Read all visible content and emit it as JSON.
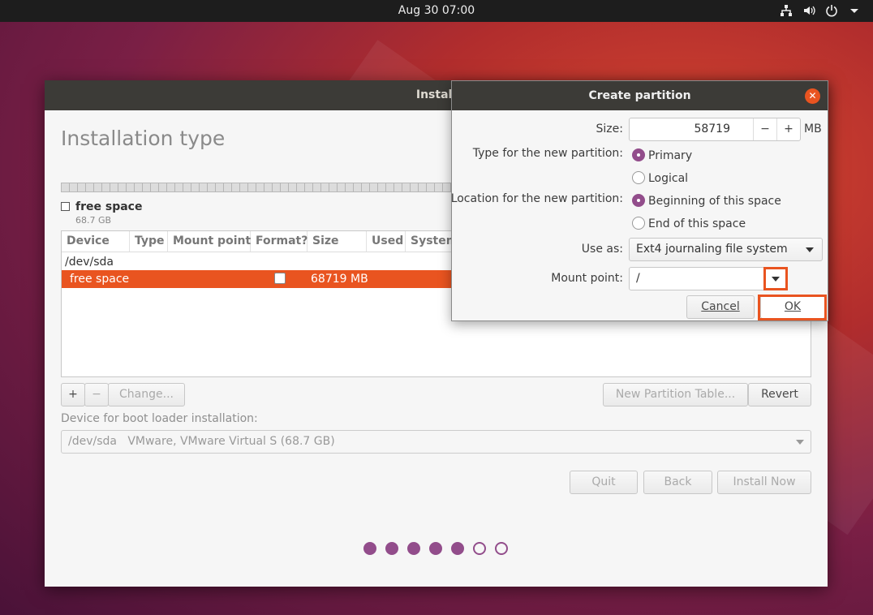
{
  "topbar": {
    "clock": "Aug 30  07:00",
    "icons": [
      "network-icon",
      "volume-icon",
      "power-icon",
      "chevron-down-icon"
    ]
  },
  "installer": {
    "window_title": "Install",
    "page_title": "Installation type",
    "legend": {
      "label": "free space",
      "size": "68.7 GB"
    },
    "table": {
      "columns": [
        "Device",
        "Type",
        "Mount point",
        "Format?",
        "Size",
        "Used",
        "System"
      ],
      "device_row": "/dev/sda",
      "selected_row": {
        "device": "free space",
        "size": "68719 MB"
      }
    },
    "buttons": {
      "add": "+",
      "remove": "−",
      "change": "Change...",
      "new_table": "New Partition Table...",
      "revert": "Revert",
      "quit": "Quit",
      "back": "Back",
      "install_now": "Install Now"
    },
    "boot_loader": {
      "label": "Device for boot loader installation:",
      "value": "/dev/sda   VMware, VMware Virtual S (68.7 GB)"
    },
    "progress": {
      "total": 7,
      "completed": 5
    }
  },
  "dialog": {
    "title": "Create partition",
    "size": {
      "label": "Size:",
      "value": "58719",
      "unit": "MB",
      "minus": "−",
      "plus": "+"
    },
    "type": {
      "label": "Type for the new partition:",
      "options": [
        "Primary",
        "Logical"
      ],
      "selected": "Primary"
    },
    "location": {
      "label": "Location for the new partition:",
      "options": [
        "Beginning of this space",
        "End of this space"
      ],
      "selected": "Beginning of this space"
    },
    "use_as": {
      "label": "Use as:",
      "value": "Ext4 journaling file system"
    },
    "mount_point": {
      "label": "Mount point:",
      "value": "/"
    },
    "buttons": {
      "cancel": "Cancel",
      "ok": "OK"
    },
    "highlight_color": "#e95420"
  },
  "colors": {
    "accent": "#e95420",
    "aubergine": "#924d8b",
    "titlebar": "#3c3b37"
  }
}
